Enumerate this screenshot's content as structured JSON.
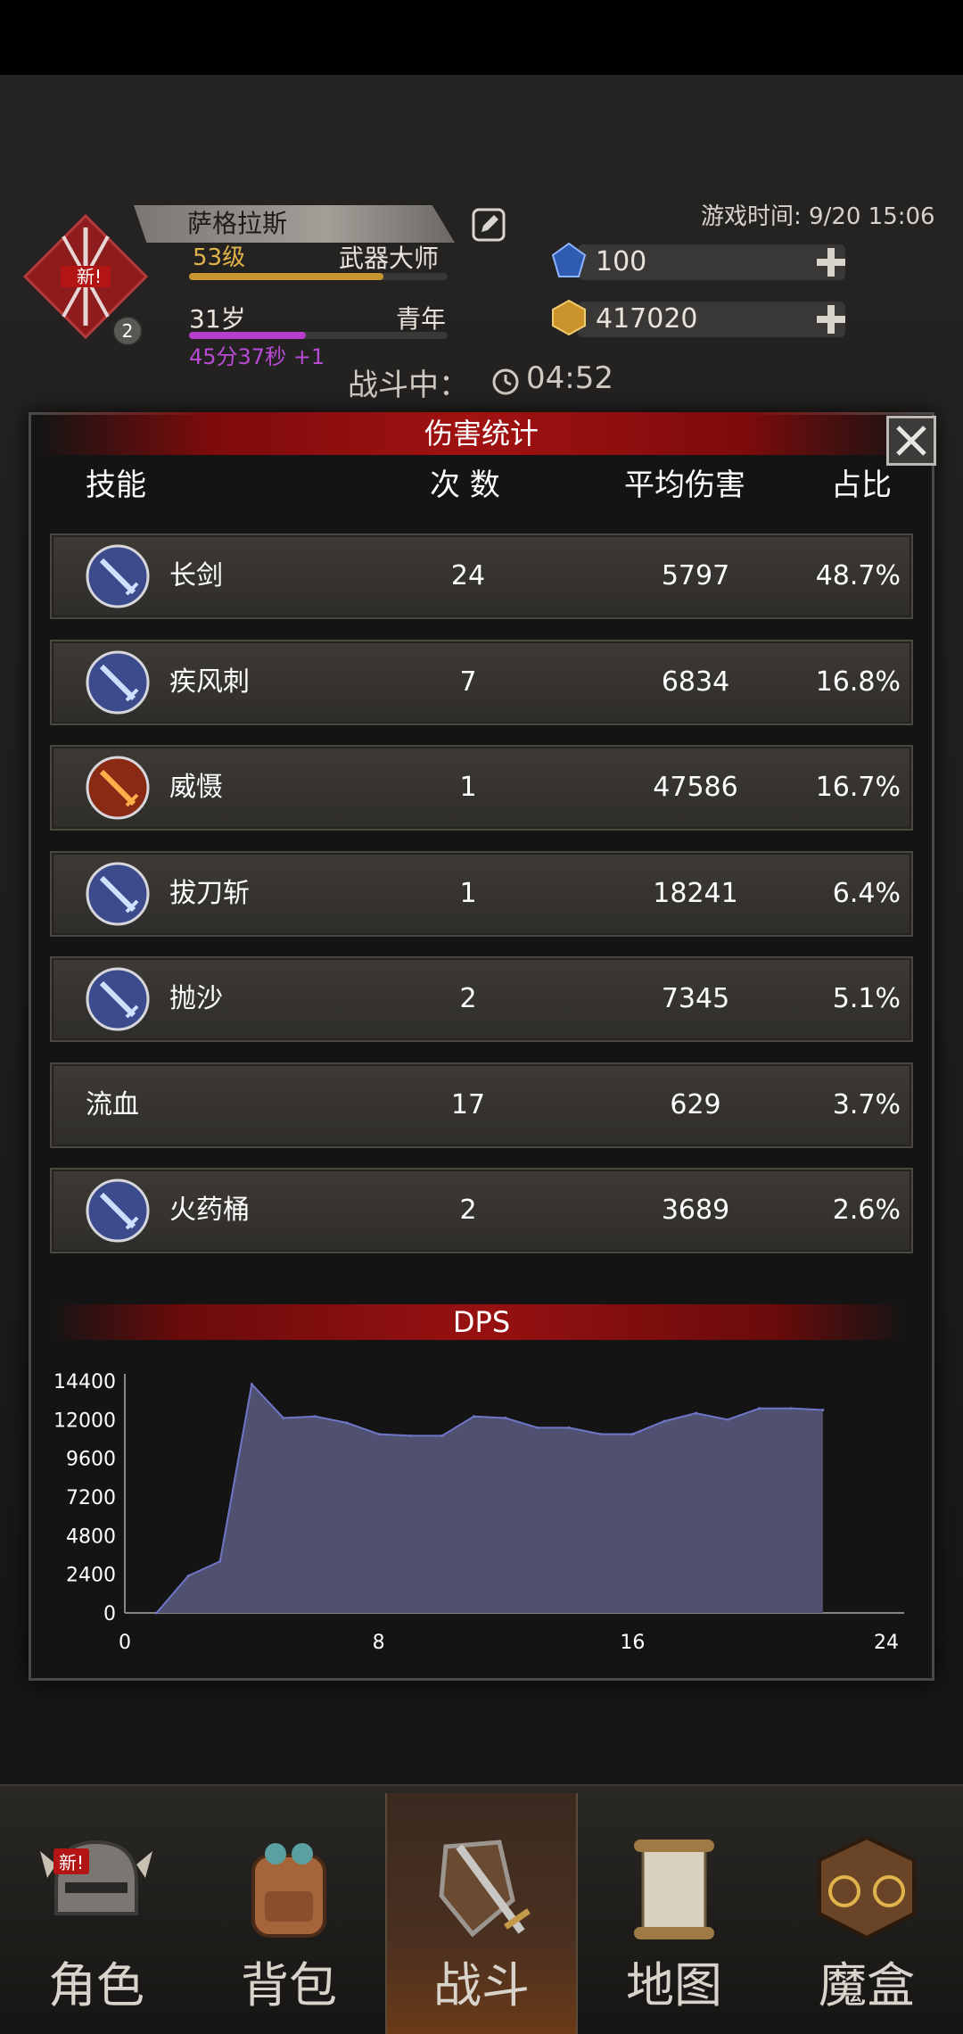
{
  "header": {
    "character_name": "萨格拉斯",
    "level": "53级",
    "title": "武器大师",
    "age": "31岁",
    "life_stage": "青年",
    "age_timer": "45分37秒 +1",
    "avatar_new_tag": "新!",
    "avatar_badge": "2",
    "game_time": "游戏时间: 9/20 15:06",
    "gems": "100",
    "gold": "417020",
    "xp_fraction": 0.75,
    "age_fraction": 0.45
  },
  "battle": {
    "status_label": "战斗中：",
    "time": "04:52"
  },
  "modal": {
    "title": "伤害统计",
    "close_icon": "close-icon",
    "columns": {
      "skill": "技能",
      "count": "次 数",
      "avg_damage": "平均伤害",
      "share": "占比"
    },
    "rows": [
      {
        "name": "长剑",
        "count": "24",
        "avg": "5797",
        "share": "48.7%",
        "icon": "sword-icon"
      },
      {
        "name": "疾风刺",
        "count": "7",
        "avg": "6834",
        "share": "16.8%",
        "icon": "gale-thrust-icon"
      },
      {
        "name": "威慑",
        "count": "1",
        "avg": "47586",
        "share": "16.7%",
        "icon": "intimidate-icon"
      },
      {
        "name": "拔刀斩",
        "count": "1",
        "avg": "18241",
        "share": "6.4%",
        "icon": "draw-slash-icon"
      },
      {
        "name": "抛沙",
        "count": "2",
        "avg": "7345",
        "share": "5.1%",
        "icon": "sand-throw-icon"
      },
      {
        "name": "流血",
        "count": "17",
        "avg": "629",
        "share": "3.7%",
        "icon": ""
      },
      {
        "name": "火药桶",
        "count": "2",
        "avg": "3689",
        "share": "2.6%",
        "icon": "powder-keg-icon"
      }
    ]
  },
  "dps": {
    "title": "DPS"
  },
  "chart_data": {
    "type": "area",
    "title": "DPS",
    "xlabel": "",
    "ylabel": "",
    "xlim": [
      0,
      24
    ],
    "ylim": [
      0,
      14400
    ],
    "xticks": [
      "0",
      "8",
      "16",
      "24"
    ],
    "yticks": [
      "0",
      "2400",
      "4800",
      "7200",
      "9600",
      "12000",
      "14400"
    ],
    "grid": false,
    "series": [
      {
        "color": "#505070",
        "x": [
          1,
          2,
          3,
          4,
          5,
          6,
          7,
          8,
          9,
          10,
          11,
          12,
          13,
          14,
          15,
          16,
          17,
          18,
          19,
          20,
          21,
          22
        ],
        "y": [
          0,
          2300,
          3200,
          14200,
          12100,
          12200,
          11800,
          11100,
          11000,
          11000,
          12200,
          12100,
          11500,
          11500,
          11100,
          11100,
          11900,
          12400,
          12000,
          12700,
          12700,
          12600
        ]
      }
    ]
  },
  "nav": {
    "items": [
      {
        "label": "角色",
        "icon": "helmet-icon",
        "new_tag": "新!"
      },
      {
        "label": "背包",
        "icon": "backpack-icon"
      },
      {
        "label": "战斗",
        "icon": "shield-sword-icon"
      },
      {
        "label": "地图",
        "icon": "scroll-map-icon"
      },
      {
        "label": "魔盒",
        "icon": "magic-box-icon"
      }
    ]
  }
}
